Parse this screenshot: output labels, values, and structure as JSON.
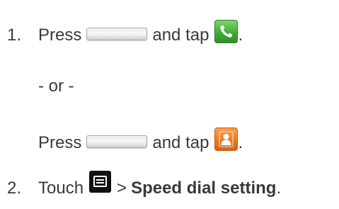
{
  "steps": {
    "step1": {
      "number": "1.",
      "press_text": "Press",
      "and_tap_text": "and tap",
      "period": "."
    },
    "or_text": "- or -",
    "alt": {
      "press_text": "Press",
      "and_tap_text": "and tap",
      "period": "."
    },
    "step2": {
      "number": "2.",
      "touch_text": "Touch",
      "separator": ">",
      "bold_text": "Speed dial setting",
      "period": "."
    }
  },
  "icons": {
    "home_button": "home-key",
    "phone_app": "phone-icon",
    "contacts_app": "contacts-icon",
    "menu_key": "menu-icon"
  },
  "colors": {
    "text": "#3a3a3a",
    "phone_green": "#3fae3a",
    "contacts_orange": "#ea7b23",
    "menu_black": "#111111"
  }
}
